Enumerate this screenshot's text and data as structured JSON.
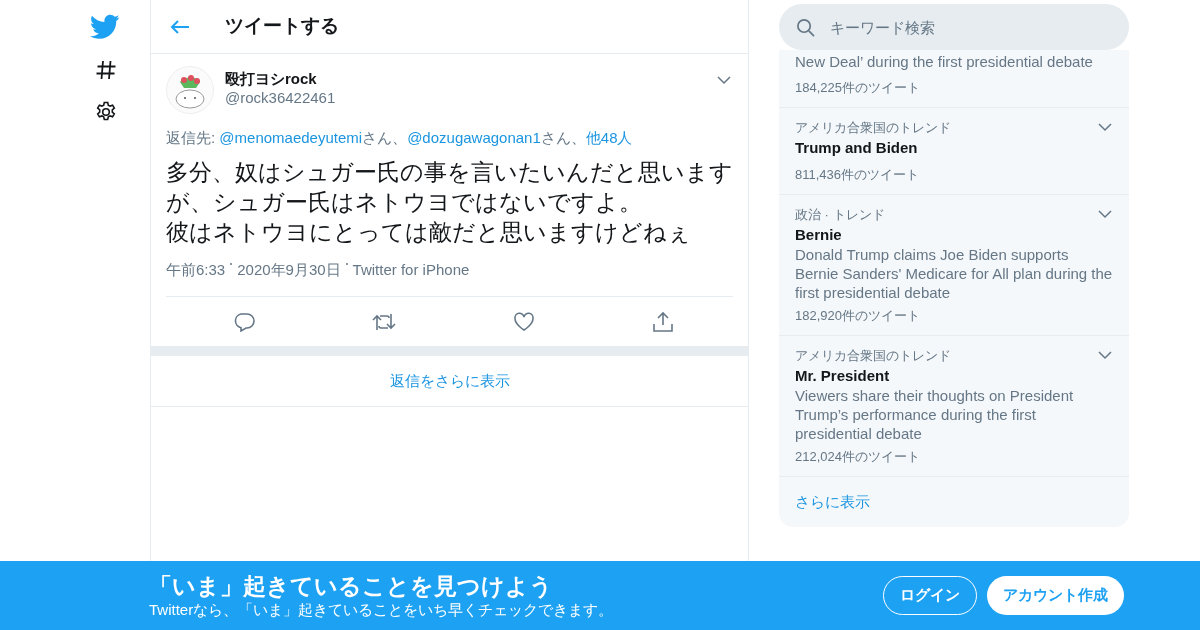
{
  "header": {
    "title": "ツイートする"
  },
  "tweet": {
    "name": "殴打ヨシrock",
    "handle": "@rock36422461",
    "reply_line": [
      {
        "kind": "plain",
        "text": "返信先: "
      },
      {
        "kind": "link",
        "text": "@menomaedeyutemi"
      },
      {
        "kind": "plain",
        "text": "さん、"
      },
      {
        "kind": "link",
        "text": "@dozugawagonan1"
      },
      {
        "kind": "plain",
        "text": "さん、"
      },
      {
        "kind": "link",
        "text": "他48人"
      }
    ],
    "text_lines": [
      "多分、奴はシュガー氏の事を言いたいんだと思いますが、シュガー氏はネトウヨではないですよ。",
      "彼はネトウヨにとっては敵だと思いますけどねぇ"
    ],
    "meta": [
      "午前6:33",
      "2020年9月30日",
      "Twitter for iPhone"
    ]
  },
  "more_replies": "返信をさらに表示",
  "search": {
    "placeholder": "キーワード検索"
  },
  "trends": [
    {
      "description": "New Deal’ during the first presidential debate",
      "count": "184,225件のツイート"
    },
    {
      "category": "アメリカ合衆国のトレンド",
      "title": "Trump and Biden",
      "count": "811,436件のツイート"
    },
    {
      "category": "政治 · トレンド",
      "title": "Bernie",
      "description": "Donald Trump claims Joe Biden supports Bernie Sanders' Medicare for All plan during the first presidential debate",
      "count": "182,920件のツイート"
    },
    {
      "category": "アメリカ合衆国のトレンド",
      "title": "Mr. President",
      "description": "Viewers share their thoughts on President Trump’s performance during the first presidential debate",
      "count": "212,024件のツイート"
    }
  ],
  "show_more": "さらに表示",
  "banner": {
    "title": "「いま」起きていることを見つけよう",
    "subtitle": "Twitterなら、「いま」起きていることをいち早くチェックできます。",
    "buttons": [
      {
        "kind": "outline",
        "label": "ログイン"
      },
      {
        "kind": "solid",
        "label": "アカウント作成"
      }
    ]
  }
}
